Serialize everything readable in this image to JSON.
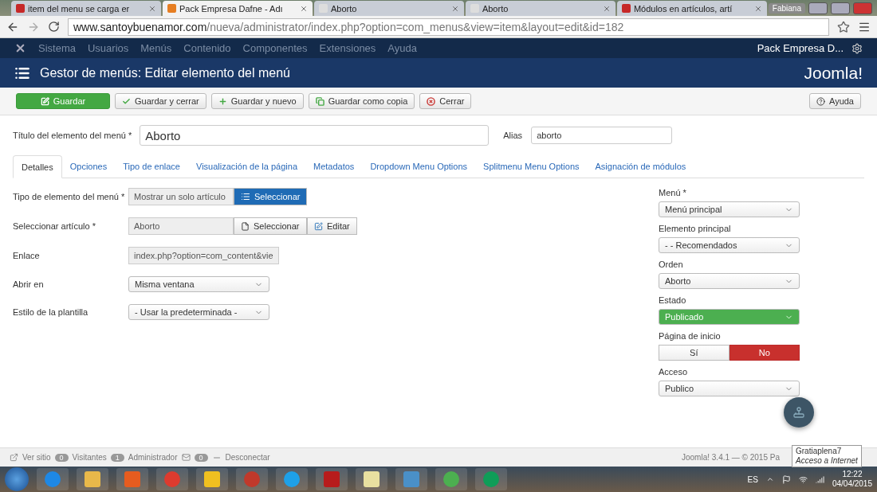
{
  "browser": {
    "tabs": [
      {
        "label": "item del menu se carga er",
        "selected": false,
        "kind": "w"
      },
      {
        "label": "Pack Empresa Dafne - Adı",
        "selected": true,
        "kind": "joomla"
      },
      {
        "label": "Aborto",
        "selected": false,
        "kind": "page"
      },
      {
        "label": "Aborto",
        "selected": false,
        "kind": "page"
      },
      {
        "label": "Módulos en artículos, artí",
        "selected": false,
        "kind": "w"
      }
    ],
    "user": "Fabiana",
    "url_host": "www.santoybuenamor.com",
    "url_path": "/nueva/administrator/index.php?option=com_menus&view=item&layout=edit&id=182"
  },
  "nav": {
    "items": [
      "Sistema",
      "Usuarios",
      "Menús",
      "Contenido",
      "Componentes",
      "Extensiones",
      "Ayuda"
    ],
    "site": "Pack Empresa D..."
  },
  "header": {
    "title": "Gestor de menús: Editar elemento del menú",
    "logo": "Joomla!"
  },
  "toolbar": [
    {
      "label": "Guardar",
      "kind": "primary"
    },
    {
      "label": "Guardar y cerrar",
      "kind": "check"
    },
    {
      "label": "Guardar y nuevo",
      "kind": "plus"
    },
    {
      "label": "Guardar como copia",
      "kind": "copy"
    },
    {
      "label": "Cerrar",
      "kind": "close"
    }
  ],
  "help": "Ayuda",
  "title_field": {
    "label": "Título del elemento del menú *",
    "value": "Aborto"
  },
  "alias_field": {
    "label": "Alias",
    "value": "aborto"
  },
  "tabs": [
    {
      "label": "Detalles",
      "selected": true
    },
    {
      "label": "Opciones",
      "selected": false
    },
    {
      "label": "Tipo de enlace",
      "selected": false
    },
    {
      "label": "Visualización de la página",
      "selected": false
    },
    {
      "label": "Metadatos",
      "selected": false
    },
    {
      "label": "Dropdown Menu Options",
      "selected": false
    },
    {
      "label": "Splitmenu Menu Options",
      "selected": false
    },
    {
      "label": "Asignación de módulos",
      "selected": false
    }
  ],
  "fields": [
    {
      "label": "Tipo de elemento del menú *",
      "kind": "type",
      "value": "Mostrar un solo artículo",
      "button": "Seleccionar"
    },
    {
      "label": "Seleccionar artículo *",
      "kind": "article",
      "value": "Aborto",
      "button": "Seleccionar",
      "edit": "Editar"
    },
    {
      "label": "Enlace",
      "kind": "text",
      "value": "index.php?option=com_content&vie"
    },
    {
      "label": "Abrir en",
      "kind": "select",
      "value": "Misma ventana"
    },
    {
      "label": "Estilo de la plantilla",
      "kind": "select",
      "value": "- Usar la predeterminada -"
    }
  ],
  "side": [
    {
      "label": "Menú *",
      "kind": "select",
      "value": "Menú principal"
    },
    {
      "label": "Elemento principal",
      "kind": "select",
      "value": "- - Recomendados"
    },
    {
      "label": "Orden",
      "kind": "select",
      "value": "Aborto"
    },
    {
      "label": "Estado",
      "kind": "status",
      "value": "Publicado"
    },
    {
      "label": "Página de inicio",
      "kind": "toggle",
      "options": [
        {
          "label": "Sí",
          "selected": false
        },
        {
          "label": "No",
          "selected": true
        }
      ]
    },
    {
      "label": "Acceso",
      "kind": "select",
      "value": "Publico"
    }
  ],
  "status": {
    "view": "Ver sitio",
    "visitors": "0",
    "visitors_label": "Visitantes",
    "admins": "1",
    "admins_label": "Administrador",
    "messages": "0",
    "logout": "Desconectar",
    "version": "Joomla! 3.4.1  —  © 2015 Pa"
  },
  "tooltip": {
    "title": "Gratiaplena7",
    "subtitle": "Acceso a Internet"
  },
  "tray": {
    "lang": "ES",
    "time": "12:22",
    "date": "04/04/2015"
  }
}
